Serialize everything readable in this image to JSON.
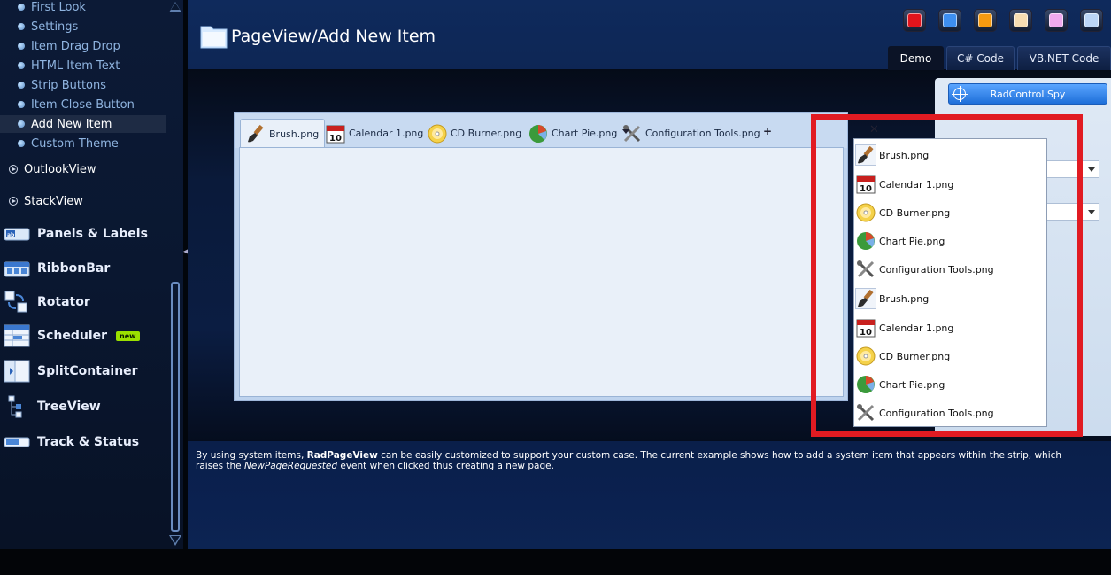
{
  "sidebar": {
    "sub_items": [
      {
        "label": "First Look"
      },
      {
        "label": "Settings"
      },
      {
        "label": "Item Drag Drop"
      },
      {
        "label": "HTML Item Text"
      },
      {
        "label": "Strip Buttons"
      },
      {
        "label": "Item Close Button"
      },
      {
        "label": "Add New Item"
      },
      {
        "label": "Custom Theme"
      }
    ],
    "selected_sub_item": "Add New Item",
    "sections": [
      {
        "label": "OutlookView"
      },
      {
        "label": "StackView"
      }
    ],
    "categories": [
      {
        "label": "Panels & Labels",
        "icon": "panels-labels-icon"
      },
      {
        "label": "RibbonBar",
        "icon": "ribbonbar-icon"
      },
      {
        "label": "Rotator",
        "icon": "rotator-icon"
      },
      {
        "label": "Scheduler",
        "icon": "scheduler-icon",
        "badge": "new"
      },
      {
        "label": "SplitContainer",
        "icon": "splitcontainer-icon"
      },
      {
        "label": "TreeView",
        "icon": "treeview-icon"
      },
      {
        "label": "Track & Status",
        "icon": "track-status-icon"
      }
    ]
  },
  "header": {
    "title": "PageView/Add New Item",
    "theme_swatches": [
      {
        "name": "red",
        "color": "#e0141c"
      },
      {
        "name": "blue",
        "color": "#3d8ff0"
      },
      {
        "name": "orange",
        "color": "#f59a10"
      },
      {
        "name": "cream",
        "color": "#f7deb2"
      },
      {
        "name": "pink",
        "color": "#f0a9ee"
      },
      {
        "name": "light-blue",
        "color": "#bcd6f6"
      }
    ],
    "code_tabs": [
      {
        "label": "Demo",
        "active": true
      },
      {
        "label": "C# Code",
        "active": false
      },
      {
        "label": "VB.NET Code",
        "active": false
      }
    ]
  },
  "settings_panel": {
    "spy_button": "RadControl Spy"
  },
  "pageview": {
    "tabs": [
      {
        "label": "Brush.png",
        "icon": "brush-icon",
        "active": true
      },
      {
        "label": "Calendar 1.png",
        "icon": "calendar-icon",
        "active": false
      },
      {
        "label": "CD Burner.png",
        "icon": "cd-burner-icon",
        "active": false
      },
      {
        "label": "Chart Pie.png",
        "icon": "chart-pie-icon",
        "active": false
      },
      {
        "label": "Configuration Tools.png",
        "icon": "config-tools-icon",
        "active": false
      }
    ],
    "new_tab_symbol": "+",
    "close_symbol": "✕",
    "overflow_menu": [
      {
        "label": "Brush.png",
        "icon": "brush-icon"
      },
      {
        "label": "Calendar 1.png",
        "icon": "calendar-icon"
      },
      {
        "label": "CD Burner.png",
        "icon": "cd-burner-icon"
      },
      {
        "label": "Chart Pie.png",
        "icon": "chart-pie-icon"
      },
      {
        "label": "Configuration Tools.png",
        "icon": "config-tools-icon"
      },
      {
        "label": "Brush.png",
        "icon": "brush-icon"
      },
      {
        "label": "Calendar 1.png",
        "icon": "calendar-icon"
      },
      {
        "label": "CD Burner.png",
        "icon": "cd-burner-icon"
      },
      {
        "label": "Chart Pie.png",
        "icon": "chart-pie-icon"
      },
      {
        "label": "Configuration Tools.png",
        "icon": "config-tools-icon"
      }
    ],
    "calendar_day": "10"
  },
  "highlight_color": "#e11b22",
  "description": {
    "part1": "By using system items, ",
    "strong": "RadPageView",
    "part2": " can be easily customized to support your custom case. The current example shows how to add a system item that appears within the strip, which raises the ",
    "em": "NewPageRequested",
    "part3": " event when clicked thus creating a new page."
  }
}
